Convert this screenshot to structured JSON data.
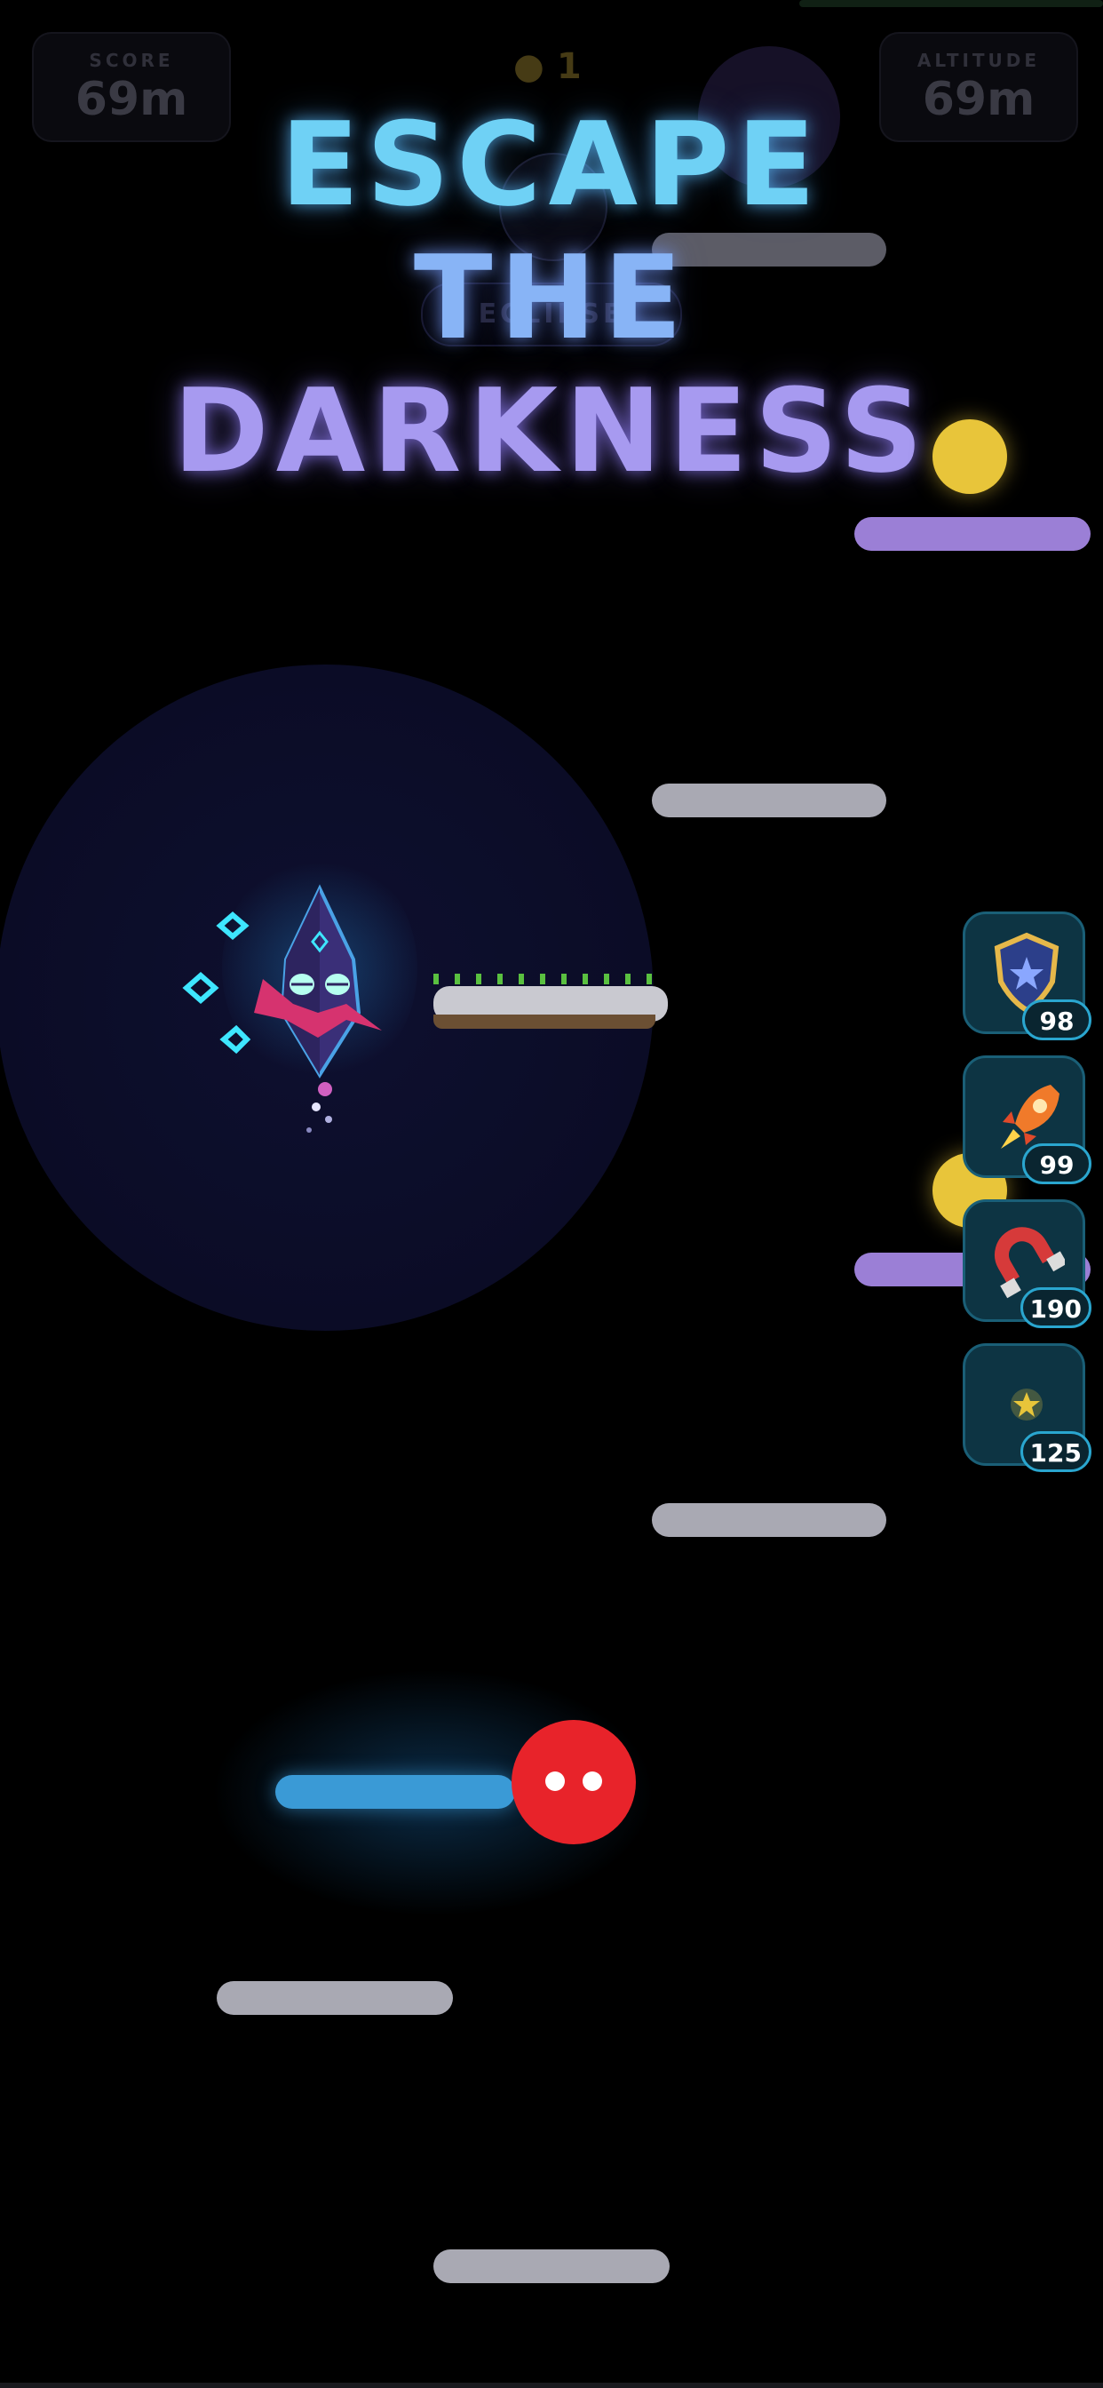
{
  "hud": {
    "score_label": "SCORE",
    "score_value": "69m",
    "altitude_label": "ALTITUDE",
    "altitude_value": "69m",
    "coins": "1",
    "mode_pill": "ECLIPSE"
  },
  "title": {
    "line1": "ESCAPE",
    "line2": "THE",
    "line3": "DARKNESS"
  },
  "powerups": [
    {
      "name": "shield",
      "count": "98"
    },
    {
      "name": "rocket",
      "count": "99"
    },
    {
      "name": "magnet",
      "count": "190"
    },
    {
      "name": "star",
      "count": "125"
    }
  ],
  "colors": {
    "background": "#000000",
    "title_top": "#6fd1f5",
    "title_bottom": "#a79af0",
    "platform_gray": "#a9a9b3",
    "platform_purple": "#9b7fd6",
    "platform_blue": "#3a9ad6",
    "enemy": "#e8232a",
    "coin": "#e8c53a",
    "powerup_border": "#2aa6cf"
  }
}
